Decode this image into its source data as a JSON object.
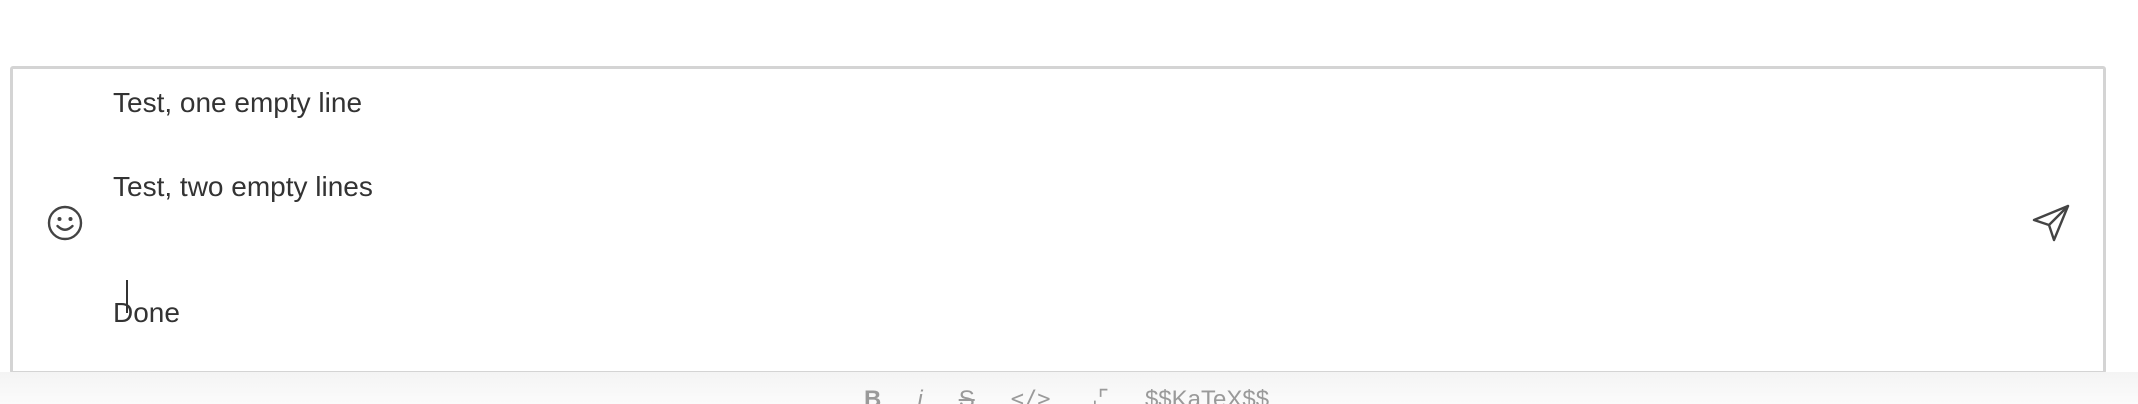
{
  "composer": {
    "lines": [
      {
        "text": "Test, one empty line"
      },
      {
        "text": ""
      },
      {
        "text": "Test, two empty lines"
      },
      {
        "text": ""
      },
      {
        "text": ""
      },
      {
        "text": "Done"
      }
    ],
    "emoji_icon": "smiley-face-icon",
    "send_icon": "paper-plane-icon"
  },
  "toolbar": {
    "items": [
      {
        "label": "B",
        "action": "bold"
      },
      {
        "label": "i",
        "action": "italic"
      },
      {
        "label": "S",
        "action": "strikethrough"
      },
      {
        "label": "</>",
        "action": "code"
      },
      {
        "label": "⌟⌜",
        "action": "expand"
      },
      {
        "label": "$$KaTeX$$",
        "action": "katex"
      }
    ]
  },
  "colors": {
    "text": "#333333",
    "border": "#d4d4d4",
    "toolbar_text": "#9a9a9a"
  }
}
